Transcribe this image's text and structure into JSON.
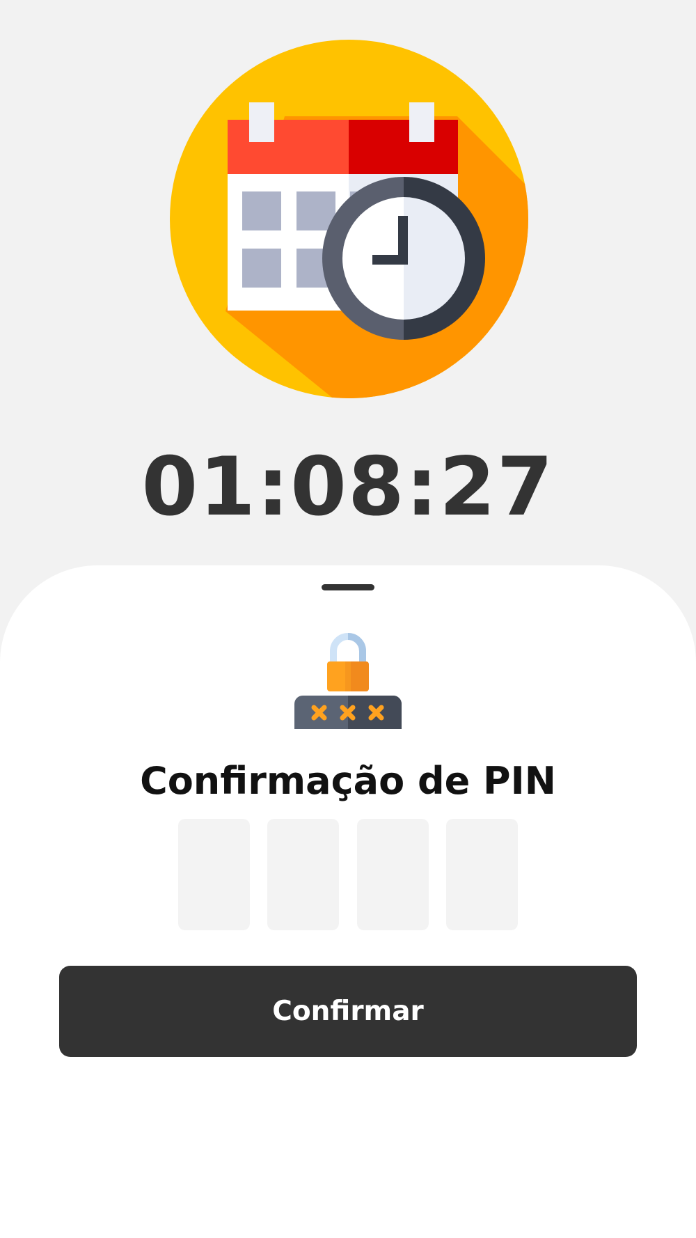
{
  "timer": {
    "countdown": "01:08:27",
    "icon": "calendar-clock-icon"
  },
  "pin_sheet": {
    "icon": "pin-lock-icon",
    "title": "Confirmação de PIN",
    "pin_digits": [
      "",
      "",
      "",
      ""
    ],
    "confirm_label": "Confirmar"
  },
  "colors": {
    "background": "#f2f2f2",
    "sheet": "#ffffff",
    "dark": "#333333",
    "pin_box": "#f3f3f3",
    "icon_yellow": "#ffc200",
    "icon_orange": "#ff9500"
  }
}
